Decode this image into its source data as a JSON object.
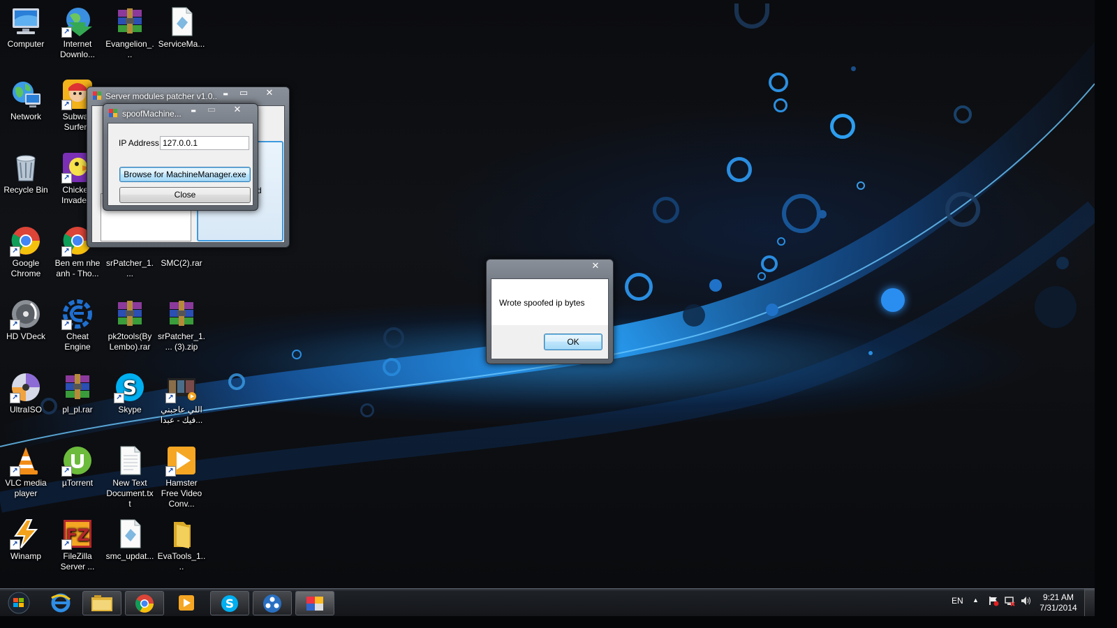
{
  "desktop_icons": [
    {
      "label": "Computer"
    },
    {
      "label": "Internet Downlo..."
    },
    {
      "label": "Evangelion_..."
    },
    {
      "label": "ServiceMa..."
    },
    {
      "label": "Network"
    },
    {
      "label": "Subway Surfers"
    },
    {
      "label": "Recycle Bin"
    },
    {
      "label": "Chicken Invaders"
    },
    {
      "label": "Google Chrome"
    },
    {
      "label": "Ben em nhe anh - Tho..."
    },
    {
      "label": "srPatcher_1...."
    },
    {
      "label": "SMC(2).rar"
    },
    {
      "label": "HD VDeck"
    },
    {
      "label": "Cheat Engine"
    },
    {
      "label": "pk2tools(By Lembo).rar"
    },
    {
      "label": "srPatcher_1.... (3).zip"
    },
    {
      "label": "UltraISO"
    },
    {
      "label": "pl_pl.rar"
    },
    {
      "label": "Skype"
    },
    {
      "label": "اللي عاجبني فيك - عبدا..."
    },
    {
      "label": "VLC media player"
    },
    {
      "label": "µTorrent"
    },
    {
      "label": "New Text Document.txt"
    },
    {
      "label": "Hamster Free Video Conv..."
    },
    {
      "label": "Winamp"
    },
    {
      "label": "FileZilla Server ..."
    },
    {
      "label": "smc_updat..."
    },
    {
      "label": "EvaTools_1...."
    }
  ],
  "patcher_window": {
    "title": "Server modules patcher v1.0...",
    "partial_text": "d"
  },
  "spoof_window": {
    "title": "spoofMachine...",
    "ip_label": "IP Address",
    "ip_value": "127.0.0.1",
    "browse_button": "Browse for MachineManager.exe",
    "close_button": "Close"
  },
  "message_box": {
    "message": "Wrote spoofed ip bytes",
    "ok_button": "OK"
  },
  "caption_glyphs": {
    "minimize": "▬",
    "maximize": "▭",
    "close": "✕"
  },
  "taskbar": {
    "pinned": [
      "windows-explorer",
      "google-chrome",
      "media-player",
      "skype",
      "network-app",
      "server-patcher"
    ],
    "language": "EN",
    "time": "9:21 AM",
    "date": "7/31/2014"
  },
  "colors": {
    "accent": "#2b8de0",
    "os_blue": "#1e78d8"
  }
}
